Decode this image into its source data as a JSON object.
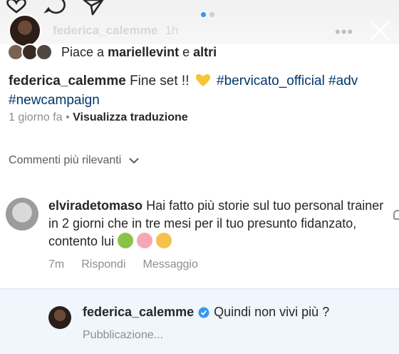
{
  "story": {
    "username": "federica_calemme",
    "time": "1h",
    "icons": [
      "heart-icon",
      "comment-icon",
      "share-icon",
      "more-icon",
      "close-icon"
    ]
  },
  "post": {
    "likes_prefix": "Piace a",
    "likes_user": "mariellevint",
    "likes_and": "e",
    "likes_others": "altri",
    "caption_user": "federica_calemme",
    "caption_text": "Fine set !!",
    "hashtag_1": "#bervicato_official",
    "hashtag_2": "#adv",
    "hashtag_3": "#newcampaign",
    "age": "1 giorno fa",
    "separator": "•",
    "translate": "Visualizza traduzione"
  },
  "comments": {
    "sort_label": "Commenti più rilevanti",
    "comment": {
      "user": "elviradetomaso",
      "text": "Hai fatto più storie sul tuo personal trainer in 2 giorni che in tre mesi per il tuo presunto fidanzato, contento lui",
      "age": "7m",
      "reply_label": "Rispondi",
      "message_label": "Messaggio"
    },
    "reply": {
      "user": "federica_calemme",
      "text": "Quindi non vivi più ?",
      "status": "Pubblicazione..."
    }
  },
  "colors": {
    "accent": "#3897f0",
    "hashtag": "#00376b",
    "reply_bg": "#eff6fc",
    "muted": "#8e8e8e"
  }
}
